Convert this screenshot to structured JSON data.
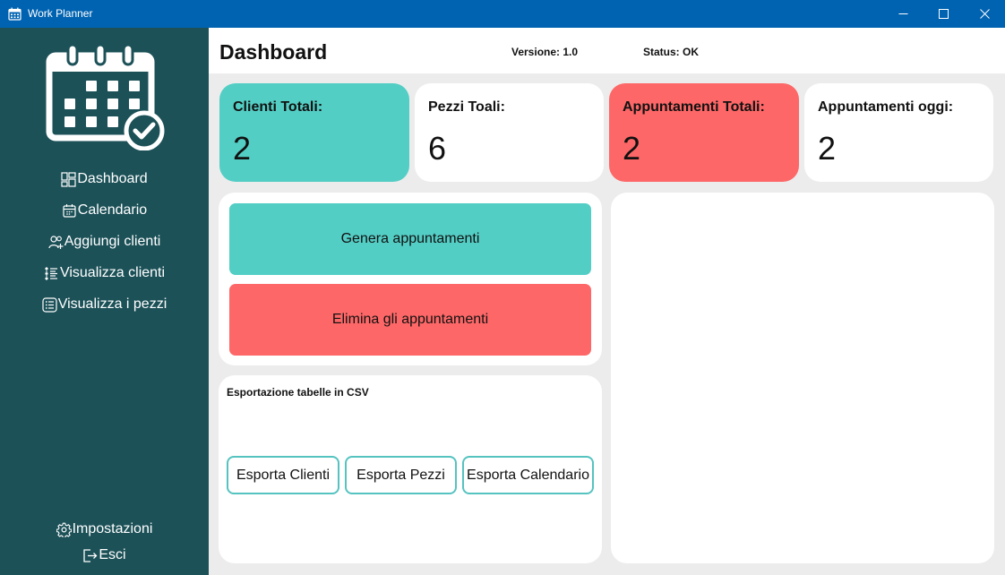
{
  "window": {
    "title": "Work Planner",
    "minimize_icon": "minimize-icon",
    "maximize_icon": "maximize-icon",
    "close_icon": "close-icon"
  },
  "sidebar": {
    "logo_icon": "calendar-check-icon",
    "nav": [
      {
        "label": "Dashboard",
        "icon": "dashboard-grid-icon"
      },
      {
        "label": "Calendario",
        "icon": "calendar-icon"
      },
      {
        "label": "Aggiungi clienti",
        "icon": "add-user-icon"
      },
      {
        "label": "Visualizza clienti",
        "icon": "list-icon"
      },
      {
        "label": "Visualizza i pezzi",
        "icon": "list-box-icon"
      }
    ],
    "footer": [
      {
        "label": "Impostazioni",
        "icon": "gear-icon"
      },
      {
        "label": "Esci",
        "icon": "exit-icon"
      }
    ]
  },
  "header": {
    "title": "Dashboard",
    "version": "Versione: 1.0",
    "status": "Status: OK"
  },
  "stats": [
    {
      "label": "Clienti Totali:",
      "value": "2",
      "color": "#53cec5"
    },
    {
      "label": "Pezzi Toali:",
      "value": "6",
      "color": "#ffffff"
    },
    {
      "label": "Appuntamenti Totali:",
      "value": "2",
      "color": "#fe6767"
    },
    {
      "label": "Appuntamenti oggi:",
      "value": "2",
      "color": "#ffffff"
    }
  ],
  "actions": {
    "generate": "Genera appuntamenti",
    "delete": "Elimina gli appuntamenti"
  },
  "export": {
    "title": "Esportazione tabelle in CSV",
    "buttons": [
      "Esporta Clienti",
      "Esporta Pezzi",
      "Esporta Calendario"
    ]
  },
  "colors": {
    "titlebar": "#0063b1",
    "sidebar": "#1c5158",
    "teal": "#53cec5",
    "red": "#fe6767",
    "content_bg": "#ececec"
  }
}
